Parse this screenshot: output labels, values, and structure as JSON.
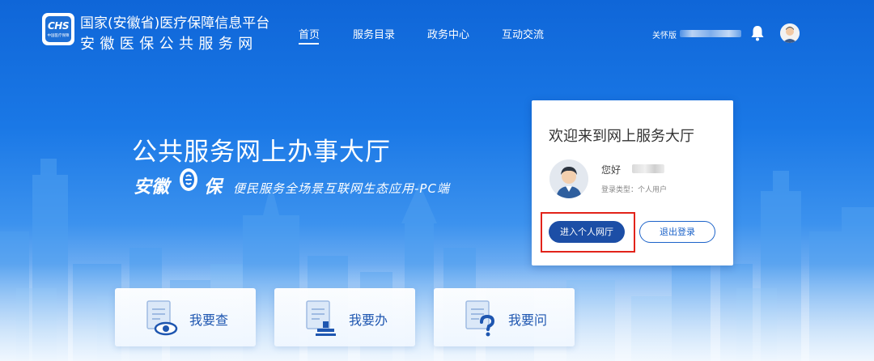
{
  "header": {
    "logo": {
      "abbr": "CHS",
      "subtext": "中国医疗保障"
    },
    "brand_line1": "国家(安徽省)医疗保障信息平台",
    "brand_line2": "安徽医保公共服务网",
    "nav": [
      {
        "label": "首页",
        "active": true
      },
      {
        "label": "服务目录",
        "active": false
      },
      {
        "label": "政务中心",
        "active": false
      },
      {
        "label": "互动交流",
        "active": false
      }
    ],
    "care_mode": "关怀版",
    "bell_icon": "bell-icon",
    "avatar_icon": "user-avatar-icon"
  },
  "hero": {
    "title": "公共服务网上办事大厅",
    "brand_part1": "安徽",
    "brand_part2": "保",
    "slogan": "便民服务全场景互联网生态应用-PC端"
  },
  "login_card": {
    "title": "欢迎来到网上服务大厅",
    "greeting": "您好",
    "login_type": "登录类型：个人用户",
    "enter_button": "进入个人网厅",
    "logout_button": "退出登录",
    "highlight_color": "#e2231a"
  },
  "services": [
    {
      "label": "我要查",
      "icon": "document-eye-icon"
    },
    {
      "label": "我要办",
      "icon": "document-stamp-icon"
    },
    {
      "label": "我要问",
      "icon": "document-question-icon"
    }
  ],
  "colors": {
    "primary": "#1c4ea6",
    "accent": "#1c63c9",
    "header_bg": "#0f66d8"
  }
}
